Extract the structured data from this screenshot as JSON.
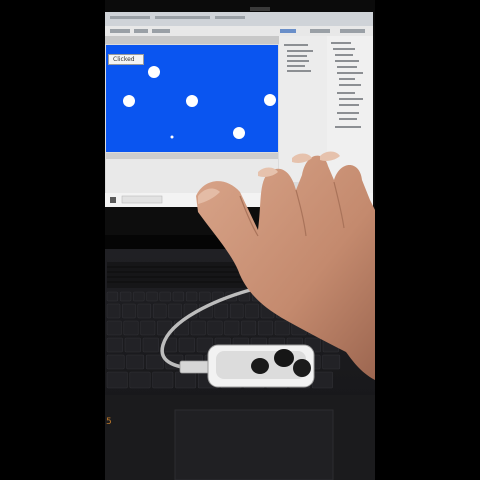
{
  "photo": {
    "subject": "laptop-with-unity-editor-hand-gesture-sensor",
    "game_view": {
      "status_label": "Clicked",
      "background_color": "#0a55f0",
      "sphere_color": "#ffffff",
      "sphere_count": 6
    },
    "laptop_badge": "5"
  },
  "colors": {
    "bezel": "#0b0b0b",
    "editor_gray": "#e2e2e2",
    "keyboard_dark": "#1a1a1c",
    "key_cap": "#222226",
    "skin": "#c9957a",
    "sensor_white": "#f2f2f2"
  }
}
